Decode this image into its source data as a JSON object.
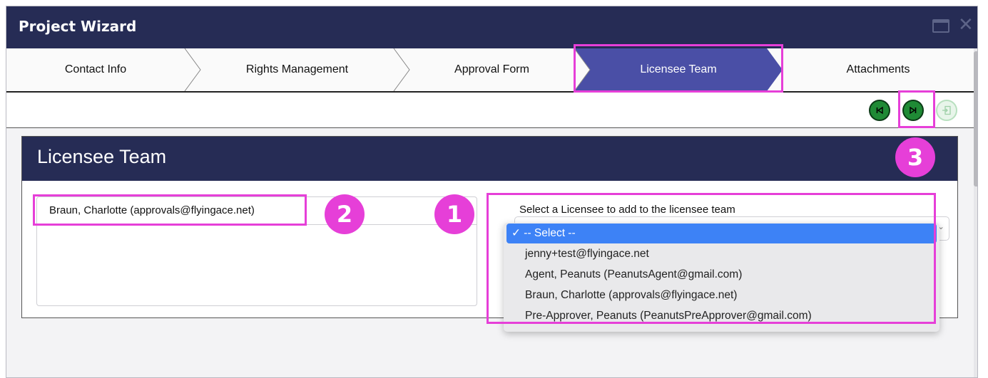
{
  "window": {
    "title": "Project Wizard"
  },
  "steps": [
    {
      "label": "Contact Info"
    },
    {
      "label": "Rights Management"
    },
    {
      "label": "Approval Form"
    },
    {
      "label": "Licensee Team",
      "active": true
    },
    {
      "label": "Attachments"
    }
  ],
  "toolbar": {
    "prev_icon": "skip-back-icon",
    "next_icon": "skip-forward-icon",
    "finish_icon": "export-icon"
  },
  "panel": {
    "title": "Licensee Team",
    "members": [
      "Braun, Charlotte (approvals@flyingace.net)"
    ],
    "select_label": "Select a Licensee to add to the licensee team"
  },
  "dropdown": {
    "options": [
      "✓ -- Select --",
      "jenny+test@flyingace.net",
      "Agent, Peanuts (PeanutsAgent@gmail.com)",
      "Braun, Charlotte (approvals@flyingace.net)",
      "Pre-Approver, Peanuts (PeanutsPreApprover@gmail.com)"
    ],
    "selected_index": 0
  },
  "annotations": {
    "badge1": "1",
    "badge2": "2",
    "badge3": "3"
  },
  "colors": {
    "header_navy": "#262c55",
    "active_step": "#4a4fa6",
    "highlight": "#e63fd8",
    "button_green": "#1f8a35",
    "select_blue": "#3d82f6"
  }
}
